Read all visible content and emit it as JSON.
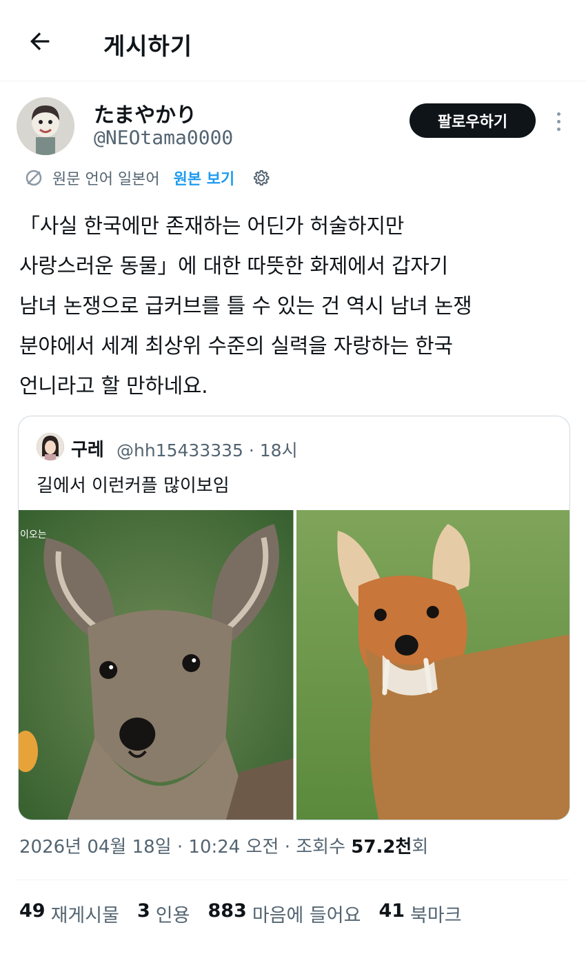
{
  "header": {
    "title": "게시하기"
  },
  "author": {
    "display_name": "たまやかり",
    "handle": "@NEOtama0000",
    "follow_label": "팔로우하기"
  },
  "translation": {
    "lang_text": "원문 언어 일본어",
    "show_original": "원본 보기"
  },
  "tweet": {
    "text": "「사실 한국에만 존재하는 어딘가 허술하지만\n사랑스러운 동물」에 대한 따뜻한 화제에서 갑자기\n남녀 논쟁으로 급커브를 틀 수 있는 건 역시 남녀 논쟁\n분야에서 세계 최상위 수준의 실력을 자랑하는 한국\n언니라고 할 만하네요."
  },
  "quote": {
    "name": "구레",
    "meta": "@hh15433335 · 18시",
    "text": "길에서 이런커플 많이보임",
    "images": [
      {
        "alt": "water-deer-photo-left",
        "watermark": "이오는"
      },
      {
        "alt": "water-deer-photo-right"
      }
    ]
  },
  "timestamp": {
    "date_time": "2026년 04월 18일 · 10:24 오전 · 조회수 ",
    "views": "57.2천",
    "views_suffix": "회"
  },
  "stats": [
    {
      "num": "49",
      "label": "재게시물"
    },
    {
      "num": "3",
      "label": "인용"
    },
    {
      "num": "883",
      "label": "마음에 들어요"
    },
    {
      "num": "41",
      "label": "북마크"
    }
  ],
  "colors": {
    "accent": "#1d9bf0",
    "text": "#0f1419",
    "muted": "#536471",
    "border": "#cfd9de"
  },
  "icons": [
    "back-arrow-icon",
    "translate-icon",
    "gear-icon",
    "more-vertical-icon"
  ]
}
